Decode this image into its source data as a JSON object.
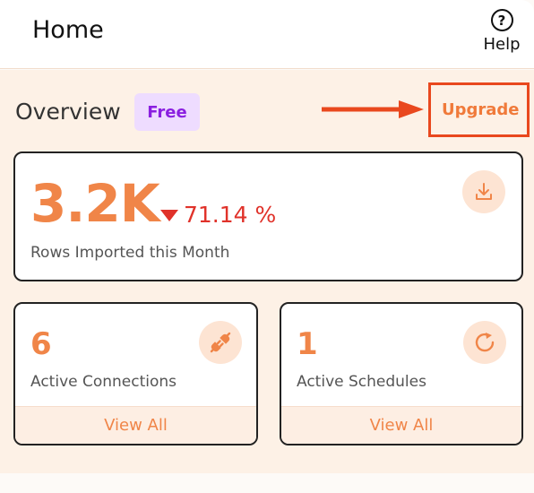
{
  "header": {
    "title": "Home",
    "help_label": "Help",
    "help_glyph": "?"
  },
  "overview": {
    "title": "Overview",
    "plan_badge": "Free",
    "upgrade_label": "Upgrade",
    "annotation_color": "#e9481e"
  },
  "rows_card": {
    "value": "3.2K",
    "change": "71.14 %",
    "change_direction": "down",
    "label": "Rows Imported this Month",
    "icon": "download-icon"
  },
  "connections_card": {
    "value": "6",
    "label": "Active Connections",
    "link": "View All",
    "icon": "plug-icon"
  },
  "schedules_card": {
    "value": "1",
    "label": "Active Schedules",
    "link": "View All",
    "icon": "refresh-icon"
  },
  "colors": {
    "accent": "#f08548",
    "negative": "#e0322a",
    "badge_bg": "#eedcff",
    "badge_text": "#8a1fe0",
    "panel_bg": "#fdf1e6"
  }
}
